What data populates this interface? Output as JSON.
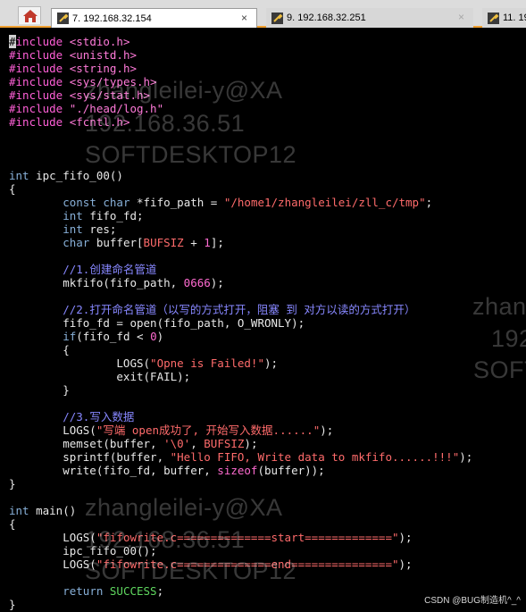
{
  "tabs": [
    {
      "label": "7. 192.168.32.154",
      "close": "×",
      "active": true
    },
    {
      "label": "9. 192.168.32.251",
      "close": "×",
      "active": false
    },
    {
      "label": "11. 19",
      "close": "",
      "active": false
    }
  ],
  "watermark": {
    "user": "zhangleilei-y@XA",
    "ip": "192.168.36.51",
    "host": "SOFTDESKTOP12",
    "user_partial": "zhan",
    "ip_partial": "192",
    "host_partial": "SOFT"
  },
  "code": [
    [
      [
        "pp-cursor",
        "#"
      ],
      [
        "pp",
        "include "
      ],
      [
        "inc",
        "<stdio.h>"
      ]
    ],
    [
      [
        "pp",
        "#include "
      ],
      [
        "inc",
        "<unistd.h>"
      ]
    ],
    [
      [
        "pp",
        "#include "
      ],
      [
        "inc",
        "<string.h>"
      ]
    ],
    [
      [
        "pp",
        "#include "
      ],
      [
        "inc",
        "<sys/types.h>"
      ]
    ],
    [
      [
        "pp",
        "#include "
      ],
      [
        "inc",
        "<sys/stat.h>"
      ]
    ],
    [
      [
        "pp",
        "#include "
      ],
      [
        "inc",
        "\"./head/log.h\""
      ]
    ],
    [
      [
        "pp",
        "#include "
      ],
      [
        "inc",
        "<fcntl.h>"
      ]
    ],
    [],
    [],
    [],
    [
      [
        "type",
        "int"
      ],
      [
        "op",
        " ipc_fifo_00()"
      ]
    ],
    [
      [
        "op",
        "{"
      ]
    ],
    [
      [
        "op",
        "        "
      ],
      [
        "type",
        "const char"
      ],
      [
        "op",
        " *fifo_path = "
      ],
      [
        "str",
        "\"/home1/zhangleilei/zll_c/tmp\""
      ],
      [
        "op",
        ";"
      ]
    ],
    [
      [
        "op",
        "        "
      ],
      [
        "type",
        "int"
      ],
      [
        "op",
        " fifo_fd;"
      ]
    ],
    [
      [
        "op",
        "        "
      ],
      [
        "type",
        "int"
      ],
      [
        "op",
        " res;"
      ]
    ],
    [
      [
        "op",
        "        "
      ],
      [
        "type",
        "char"
      ],
      [
        "op",
        " buffer["
      ],
      [
        "mac",
        "BUFSIZ"
      ],
      [
        "op",
        " + "
      ],
      [
        "num",
        "1"
      ],
      [
        "op",
        "];"
      ]
    ],
    [],
    [
      [
        "op",
        "        "
      ],
      [
        "cm",
        "//1.创建命名管道"
      ]
    ],
    [
      [
        "op",
        "        mkfifo(fifo_path, "
      ],
      [
        "num",
        "0666"
      ],
      [
        "op",
        ");"
      ]
    ],
    [],
    [
      [
        "op",
        "        "
      ],
      [
        "cm",
        "//2.打开命名管道（以写的方式打开，阻塞 到 对方以读的方式打开）"
      ]
    ],
    [
      [
        "op",
        "        fifo_fd = open(fifo_path, O_WRONLY);"
      ]
    ],
    [
      [
        "op",
        "        "
      ],
      [
        "kw",
        "if"
      ],
      [
        "op",
        "(fifo_fd < "
      ],
      [
        "num",
        "0"
      ],
      [
        "op",
        ")"
      ]
    ],
    [
      [
        "op",
        "        {"
      ]
    ],
    [
      [
        "op",
        "                LOGS("
      ],
      [
        "str",
        "\"Opne is Failed!\""
      ],
      [
        "op",
        ");"
      ]
    ],
    [
      [
        "op",
        "                exit(FAIL);"
      ]
    ],
    [
      [
        "op",
        "        }"
      ]
    ],
    [],
    [
      [
        "op",
        "        "
      ],
      [
        "cm",
        "//3.写入数据"
      ]
    ],
    [
      [
        "op",
        "        LOGS("
      ],
      [
        "str",
        "\"写端 open成功了, 开始写入数据......\""
      ],
      [
        "op",
        ");"
      ]
    ],
    [
      [
        "op",
        "        memset(buffer, "
      ],
      [
        "str",
        "'\\0'"
      ],
      [
        "op",
        ", "
      ],
      [
        "mac",
        "BUFSIZ"
      ],
      [
        "op",
        ");"
      ]
    ],
    [
      [
        "op",
        "        sprintf(buffer, "
      ],
      [
        "str",
        "\"Hello FIFO, Write data to mkfifo......!!!\""
      ],
      [
        "op",
        ");"
      ]
    ],
    [
      [
        "op",
        "        write(fifo_fd, buffer, "
      ],
      [
        "fn",
        "sizeof"
      ],
      [
        "op",
        "(buffer));"
      ]
    ],
    [
      [
        "op",
        "}"
      ]
    ],
    [],
    [
      [
        "type",
        "int"
      ],
      [
        "op",
        " main()"
      ]
    ],
    [
      [
        "op",
        "{"
      ]
    ],
    [
      [
        "op",
        "        LOGS("
      ],
      [
        "str",
        "\"fifowrite.c==============start=============\""
      ],
      [
        "op",
        ");"
      ]
    ],
    [
      [
        "op",
        "        ipc_fifo_00();"
      ]
    ],
    [
      [
        "op",
        "        LOGS("
      ],
      [
        "str",
        "\"fifowrite.c==============end===============\""
      ],
      [
        "op",
        ");"
      ]
    ],
    [],
    [
      [
        "op",
        "        "
      ],
      [
        "kw",
        "return"
      ],
      [
        "op",
        " "
      ],
      [
        "const",
        "SUCCESS"
      ],
      [
        "op",
        ";"
      ]
    ],
    [
      [
        "op",
        "}"
      ]
    ]
  ],
  "credit": "CSDN @BUG制造机^_^"
}
